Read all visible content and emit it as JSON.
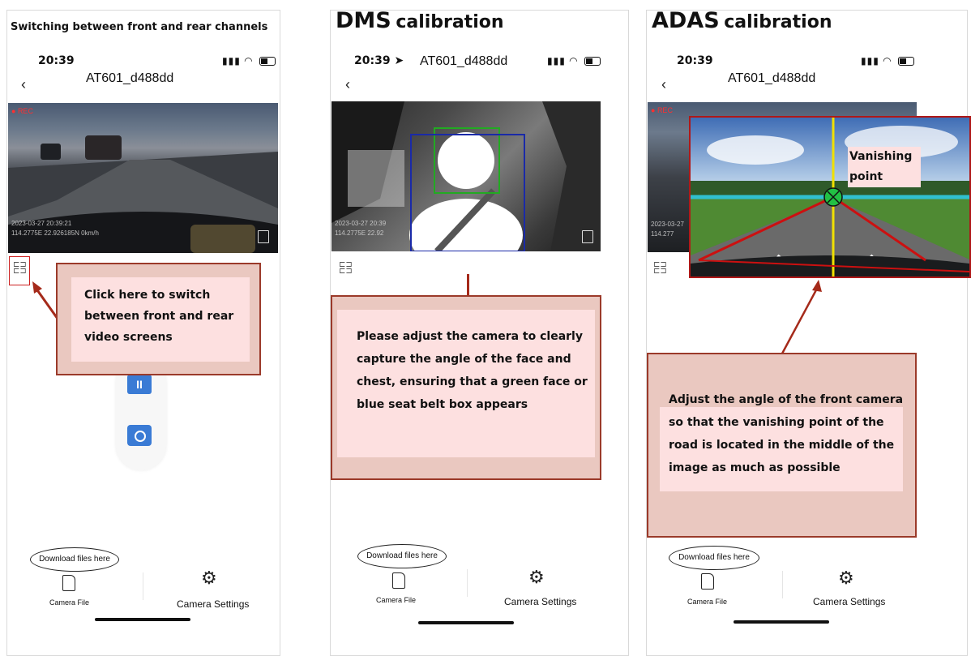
{
  "panel1": {
    "title": "Switching between front and rear channels",
    "time": "20:39",
    "device": "AT601_d488dd",
    "rec": "REC",
    "osd_line1": "2023-03-27  20:39:21",
    "osd_line2": "114.2775E  22.926185N  0km/h",
    "callout": "Click here to switch between front and rear video screens",
    "bubble": "Download files here",
    "nav_file": "Camera File",
    "nav_settings": "Camera Settings"
  },
  "panel2": {
    "title_big": "DMS",
    "title_small": "calibration",
    "time": "20:39",
    "device": "AT601_d488dd",
    "osd_line1": "2023-03-27  20:39",
    "osd_line2": "114.2775E  22.92",
    "callout": "Please adjust the camera to clearly capture the angle of the face and chest, ensuring that a green face or blue seat belt box appears",
    "bubble": "Download files here",
    "nav_file": "Camera File",
    "nav_settings": "Camera Settings"
  },
  "panel3": {
    "title_big": "ADAS",
    "title_small": "calibration",
    "time": "20:39",
    "device": "AT601_d488dd",
    "rec": "REC",
    "osd_line1": "2023-03-27",
    "osd_line2": "114.277",
    "vanishing_label": "Vanishing point",
    "callout": "Adjust the angle of the front camera so that the vanishing point of the road is located in the middle of the image as much as possible",
    "bubble": "Download files here",
    "nav_file": "Camera File",
    "nav_settings": "Camera Settings"
  },
  "colors": {
    "callout_fill": "#fcdcdc",
    "callout_border": "#9b3a2a",
    "arrow": "#a52a1a",
    "face_box": "#22aa22",
    "belt_box": "#1a2aa8",
    "vanishing_line": "#f0e000",
    "horizon_line": "#30c0d0",
    "lane_line": "#cc1010",
    "control_blue": "#3a7bd5"
  },
  "icons": [
    "switch-channel-icon",
    "fullscreen-icon",
    "pause-record-icon",
    "camera-snapshot-icon",
    "sd-card-icon",
    "gear-icon",
    "signal-icon",
    "wifi-icon",
    "battery-icon",
    "back-chevron-icon",
    "location-arrow-icon",
    "vanishing-point-marker-icon"
  ]
}
